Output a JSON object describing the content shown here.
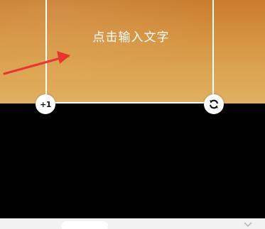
{
  "editor": {
    "text_box": {
      "placeholder": "点击输入文字"
    },
    "handles": {
      "duplicate_label": "+1",
      "rotate_icon": "rotate-icon"
    },
    "annotation": {
      "arrow_color": "#e8352f"
    }
  },
  "colors": {
    "photo_top": "#c97c2c",
    "photo_bottom": "#e1b063",
    "background": "#000000",
    "bottom_bar": "#f2f2f2"
  }
}
